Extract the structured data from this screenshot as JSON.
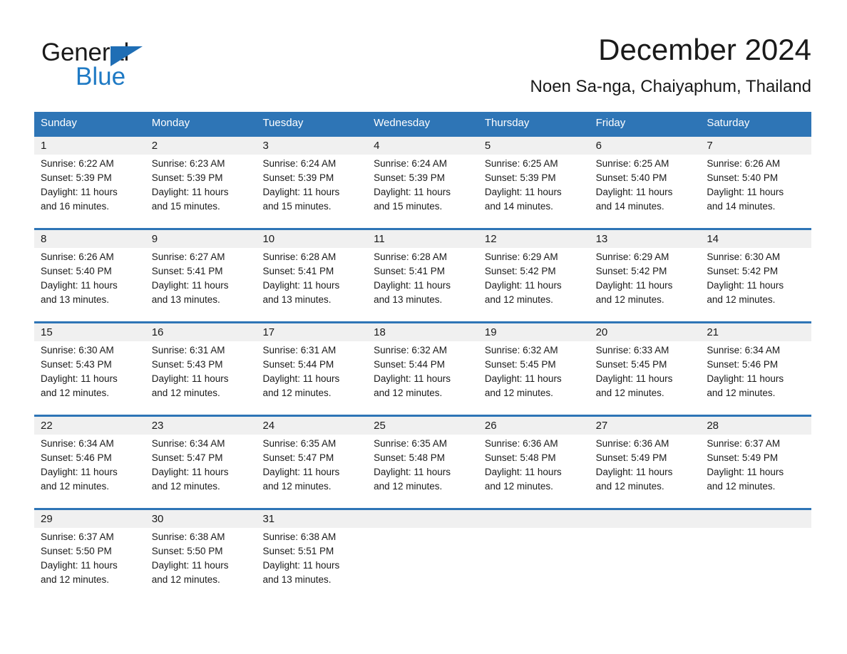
{
  "brand": {
    "name_part1": "General",
    "name_part2": "Blue",
    "logo_icon": "sail-triangle-icon",
    "color_blue": "#1f7ac4"
  },
  "header": {
    "title": "December 2024",
    "subtitle": "Noen Sa-nga, Chaiyaphum, Thailand"
  },
  "theme": {
    "header_blue": "#2e75b6",
    "daynum_band": "#f0f0f0",
    "text": "#1a1a1a"
  },
  "calendar": {
    "weekdays": [
      "Sunday",
      "Monday",
      "Tuesday",
      "Wednesday",
      "Thursday",
      "Friday",
      "Saturday"
    ],
    "weeks": [
      [
        {
          "day": "1",
          "sunrise": "Sunrise: 6:22 AM",
          "sunset": "Sunset: 5:39 PM",
          "daylight_line1": "Daylight: 11 hours",
          "daylight_line2": "and 16 minutes."
        },
        {
          "day": "2",
          "sunrise": "Sunrise: 6:23 AM",
          "sunset": "Sunset: 5:39 PM",
          "daylight_line1": "Daylight: 11 hours",
          "daylight_line2": "and 15 minutes."
        },
        {
          "day": "3",
          "sunrise": "Sunrise: 6:24 AM",
          "sunset": "Sunset: 5:39 PM",
          "daylight_line1": "Daylight: 11 hours",
          "daylight_line2": "and 15 minutes."
        },
        {
          "day": "4",
          "sunrise": "Sunrise: 6:24 AM",
          "sunset": "Sunset: 5:39 PM",
          "daylight_line1": "Daylight: 11 hours",
          "daylight_line2": "and 15 minutes."
        },
        {
          "day": "5",
          "sunrise": "Sunrise: 6:25 AM",
          "sunset": "Sunset: 5:39 PM",
          "daylight_line1": "Daylight: 11 hours",
          "daylight_line2": "and 14 minutes."
        },
        {
          "day": "6",
          "sunrise": "Sunrise: 6:25 AM",
          "sunset": "Sunset: 5:40 PM",
          "daylight_line1": "Daylight: 11 hours",
          "daylight_line2": "and 14 minutes."
        },
        {
          "day": "7",
          "sunrise": "Sunrise: 6:26 AM",
          "sunset": "Sunset: 5:40 PM",
          "daylight_line1": "Daylight: 11 hours",
          "daylight_line2": "and 14 minutes."
        }
      ],
      [
        {
          "day": "8",
          "sunrise": "Sunrise: 6:26 AM",
          "sunset": "Sunset: 5:40 PM",
          "daylight_line1": "Daylight: 11 hours",
          "daylight_line2": "and 13 minutes."
        },
        {
          "day": "9",
          "sunrise": "Sunrise: 6:27 AM",
          "sunset": "Sunset: 5:41 PM",
          "daylight_line1": "Daylight: 11 hours",
          "daylight_line2": "and 13 minutes."
        },
        {
          "day": "10",
          "sunrise": "Sunrise: 6:28 AM",
          "sunset": "Sunset: 5:41 PM",
          "daylight_line1": "Daylight: 11 hours",
          "daylight_line2": "and 13 minutes."
        },
        {
          "day": "11",
          "sunrise": "Sunrise: 6:28 AM",
          "sunset": "Sunset: 5:41 PM",
          "daylight_line1": "Daylight: 11 hours",
          "daylight_line2": "and 13 minutes."
        },
        {
          "day": "12",
          "sunrise": "Sunrise: 6:29 AM",
          "sunset": "Sunset: 5:42 PM",
          "daylight_line1": "Daylight: 11 hours",
          "daylight_line2": "and 12 minutes."
        },
        {
          "day": "13",
          "sunrise": "Sunrise: 6:29 AM",
          "sunset": "Sunset: 5:42 PM",
          "daylight_line1": "Daylight: 11 hours",
          "daylight_line2": "and 12 minutes."
        },
        {
          "day": "14",
          "sunrise": "Sunrise: 6:30 AM",
          "sunset": "Sunset: 5:42 PM",
          "daylight_line1": "Daylight: 11 hours",
          "daylight_line2": "and 12 minutes."
        }
      ],
      [
        {
          "day": "15",
          "sunrise": "Sunrise: 6:30 AM",
          "sunset": "Sunset: 5:43 PM",
          "daylight_line1": "Daylight: 11 hours",
          "daylight_line2": "and 12 minutes."
        },
        {
          "day": "16",
          "sunrise": "Sunrise: 6:31 AM",
          "sunset": "Sunset: 5:43 PM",
          "daylight_line1": "Daylight: 11 hours",
          "daylight_line2": "and 12 minutes."
        },
        {
          "day": "17",
          "sunrise": "Sunrise: 6:31 AM",
          "sunset": "Sunset: 5:44 PM",
          "daylight_line1": "Daylight: 11 hours",
          "daylight_line2": "and 12 minutes."
        },
        {
          "day": "18",
          "sunrise": "Sunrise: 6:32 AM",
          "sunset": "Sunset: 5:44 PM",
          "daylight_line1": "Daylight: 11 hours",
          "daylight_line2": "and 12 minutes."
        },
        {
          "day": "19",
          "sunrise": "Sunrise: 6:32 AM",
          "sunset": "Sunset: 5:45 PM",
          "daylight_line1": "Daylight: 11 hours",
          "daylight_line2": "and 12 minutes."
        },
        {
          "day": "20",
          "sunrise": "Sunrise: 6:33 AM",
          "sunset": "Sunset: 5:45 PM",
          "daylight_line1": "Daylight: 11 hours",
          "daylight_line2": "and 12 minutes."
        },
        {
          "day": "21",
          "sunrise": "Sunrise: 6:34 AM",
          "sunset": "Sunset: 5:46 PM",
          "daylight_line1": "Daylight: 11 hours",
          "daylight_line2": "and 12 minutes."
        }
      ],
      [
        {
          "day": "22",
          "sunrise": "Sunrise: 6:34 AM",
          "sunset": "Sunset: 5:46 PM",
          "daylight_line1": "Daylight: 11 hours",
          "daylight_line2": "and 12 minutes."
        },
        {
          "day": "23",
          "sunrise": "Sunrise: 6:34 AM",
          "sunset": "Sunset: 5:47 PM",
          "daylight_line1": "Daylight: 11 hours",
          "daylight_line2": "and 12 minutes."
        },
        {
          "day": "24",
          "sunrise": "Sunrise: 6:35 AM",
          "sunset": "Sunset: 5:47 PM",
          "daylight_line1": "Daylight: 11 hours",
          "daylight_line2": "and 12 minutes."
        },
        {
          "day": "25",
          "sunrise": "Sunrise: 6:35 AM",
          "sunset": "Sunset: 5:48 PM",
          "daylight_line1": "Daylight: 11 hours",
          "daylight_line2": "and 12 minutes."
        },
        {
          "day": "26",
          "sunrise": "Sunrise: 6:36 AM",
          "sunset": "Sunset: 5:48 PM",
          "daylight_line1": "Daylight: 11 hours",
          "daylight_line2": "and 12 minutes."
        },
        {
          "day": "27",
          "sunrise": "Sunrise: 6:36 AM",
          "sunset": "Sunset: 5:49 PM",
          "daylight_line1": "Daylight: 11 hours",
          "daylight_line2": "and 12 minutes."
        },
        {
          "day": "28",
          "sunrise": "Sunrise: 6:37 AM",
          "sunset": "Sunset: 5:49 PM",
          "daylight_line1": "Daylight: 11 hours",
          "daylight_line2": "and 12 minutes."
        }
      ],
      [
        {
          "day": "29",
          "sunrise": "Sunrise: 6:37 AM",
          "sunset": "Sunset: 5:50 PM",
          "daylight_line1": "Daylight: 11 hours",
          "daylight_line2": "and 12 minutes."
        },
        {
          "day": "30",
          "sunrise": "Sunrise: 6:38 AM",
          "sunset": "Sunset: 5:50 PM",
          "daylight_line1": "Daylight: 11 hours",
          "daylight_line2": "and 12 minutes."
        },
        {
          "day": "31",
          "sunrise": "Sunrise: 6:38 AM",
          "sunset": "Sunset: 5:51 PM",
          "daylight_line1": "Daylight: 11 hours",
          "daylight_line2": "and 13 minutes."
        },
        {
          "day": "",
          "sunrise": "",
          "sunset": "",
          "daylight_line1": "",
          "daylight_line2": ""
        },
        {
          "day": "",
          "sunrise": "",
          "sunset": "",
          "daylight_line1": "",
          "daylight_line2": ""
        },
        {
          "day": "",
          "sunrise": "",
          "sunset": "",
          "daylight_line1": "",
          "daylight_line2": ""
        },
        {
          "day": "",
          "sunrise": "",
          "sunset": "",
          "daylight_line1": "",
          "daylight_line2": ""
        }
      ]
    ]
  }
}
